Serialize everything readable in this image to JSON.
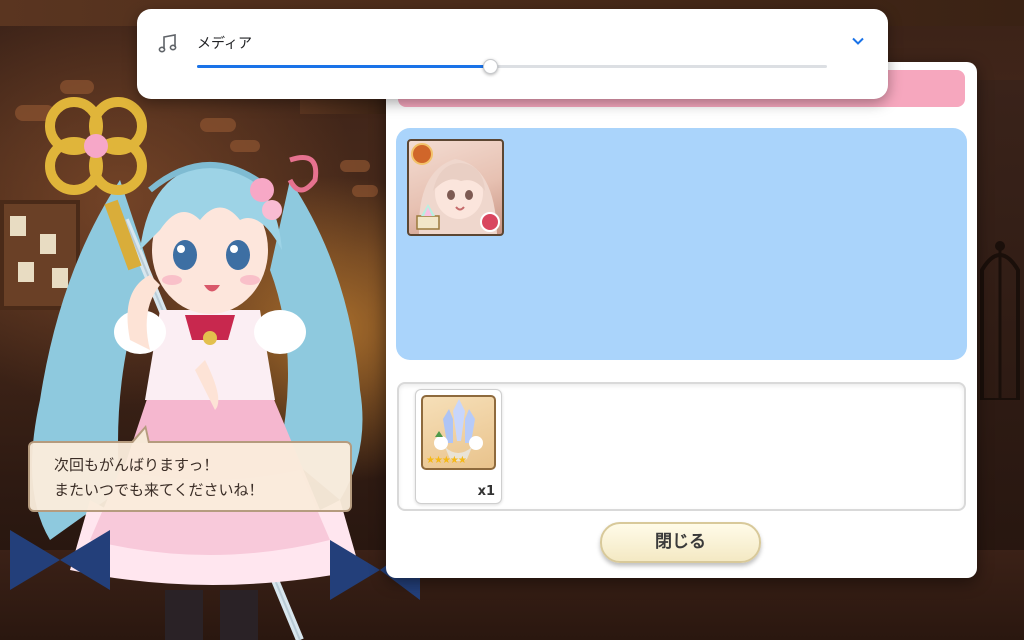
{
  "media_player": {
    "title": "メディア",
    "progress": 0.465,
    "icons": {
      "note": "music-note-icon",
      "expand": "chevron-down-icon"
    },
    "accent_color": "#1a73e8"
  },
  "result_panel": {
    "header_title": "",
    "header_color": "#f6a7be",
    "team_area_color": "#aad4fb",
    "reward": {
      "quantity": "x1",
      "stars": 5
    },
    "close_label": "閉じる"
  },
  "dialogue": {
    "line1": "次回もがんばりますっ！",
    "line2": "またいつでも来てくださいね！"
  }
}
